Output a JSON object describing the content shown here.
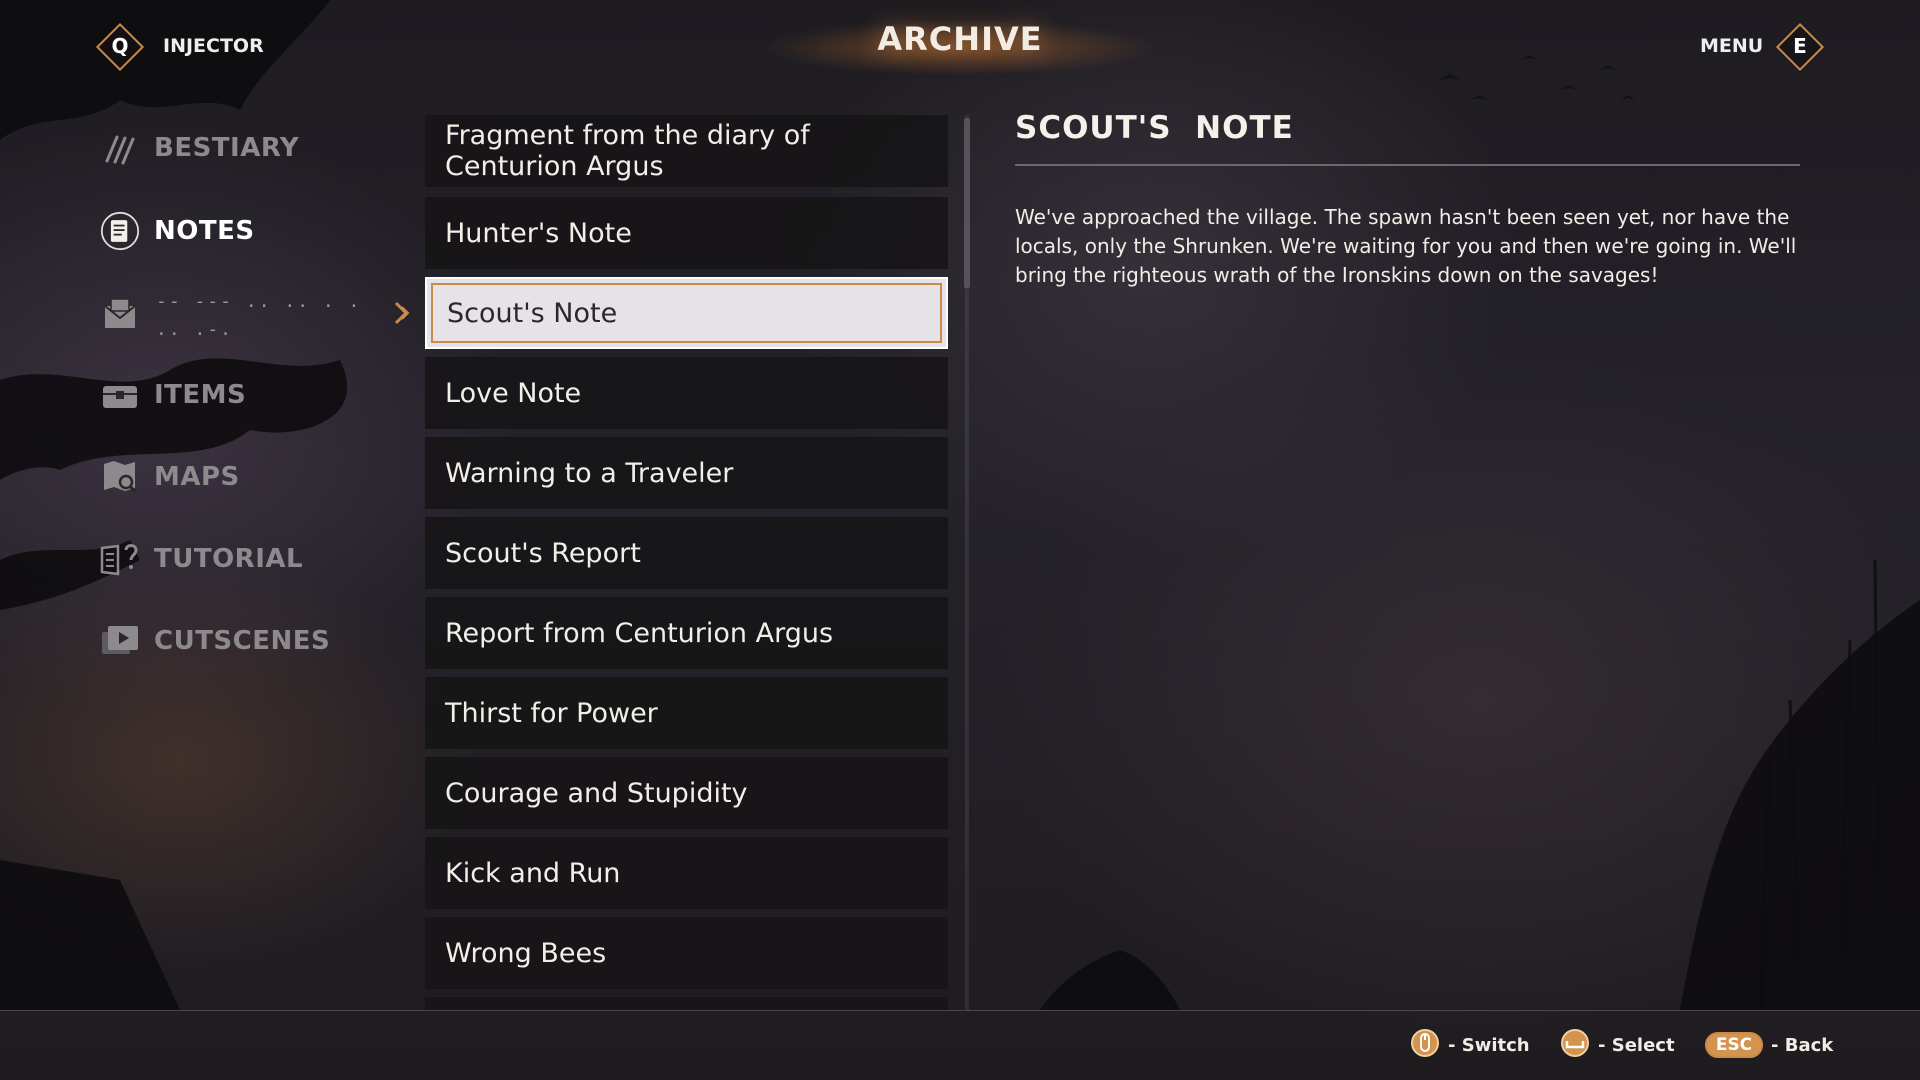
{
  "header": {
    "title": "ARCHIVE",
    "left_key": "Q",
    "left_label": "INJECTOR",
    "right_label": "MENU",
    "right_key": "E"
  },
  "nav": {
    "items": [
      {
        "label": "BESTIARY",
        "icon": "claw-icon",
        "active": false
      },
      {
        "label": "NOTES",
        "icon": "notes-icon",
        "active": true
      },
      {
        "label": "-- --- .. ..  . .\n.. .-.",
        "icon": "letter-icon",
        "active": false,
        "locked": true
      },
      {
        "label": "ITEMS",
        "icon": "chest-icon",
        "active": false
      },
      {
        "label": "MAPS",
        "icon": "map-icon",
        "active": false
      },
      {
        "label": "TUTORIAL",
        "icon": "tutorial-book-icon",
        "active": false
      },
      {
        "label": "CUTSCENES",
        "icon": "play-icon",
        "active": false
      }
    ]
  },
  "notes_list": {
    "items": [
      "Fragment from the diary of\nCenturion Argus",
      "Hunter's Note",
      "Scout's Note",
      "Love Note",
      "Warning to a Traveler",
      "Scout's Report",
      "Report from Centurion Argus",
      "Thirst for Power",
      "Courage and Stupidity",
      "Kick and Run",
      "Wrong Bees"
    ],
    "selected_index": 2
  },
  "detail": {
    "title": "SCOUT'S  NOTE",
    "body": "We've approached the village. The spawn hasn't been seen yet, nor have the locals, only the Shrunken. We're waiting for you and then we're going in. We'll bring the righteous wrath of the Ironskins down on the savages!"
  },
  "footer": {
    "hints": [
      {
        "icon": "mouse-icon",
        "label": "- Switch"
      },
      {
        "icon": "spacebar-icon",
        "label": "- Select"
      },
      {
        "key": "ESC",
        "label": "- Back"
      }
    ]
  },
  "colors": {
    "accent": "#c98b4a",
    "selected_bg": "#e6e3e6",
    "list_bg": "#161416",
    "text": "#f2eee8",
    "nav_inactive": "#8d8a8e"
  }
}
